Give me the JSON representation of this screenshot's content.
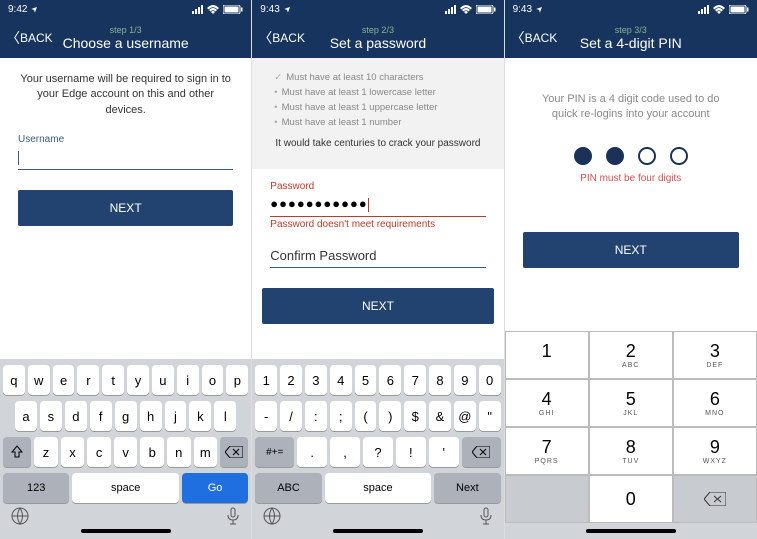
{
  "status": {
    "time": [
      "9:42",
      "9:43",
      "9:43"
    ],
    "location_arrow": "➤"
  },
  "screens": [
    {
      "back": "BACK",
      "step": "step 1/3",
      "title": "Choose a username",
      "helper": "Your username will be required to sign in to your Edge account on this and other devices.",
      "field_label": "Username",
      "next": "NEXT"
    },
    {
      "back": "BACK",
      "step": "step 2/3",
      "title": "Set a password",
      "rules": [
        "Must have at least 10 characters",
        "Must have at least 1 lowercase letter",
        "Must have at least 1 uppercase letter",
        "Must have at least 1 number"
      ],
      "crack": "It would take centuries to crack your password",
      "pw_label": "Password",
      "pw_value": "●●●●●●●●●●●",
      "pw_error": "Password doesn't meet requirements",
      "confirm_label": "Confirm Password",
      "next": "NEXT"
    },
    {
      "back": "BACK",
      "step": "step 3/3",
      "title": "Set a 4-digit PIN",
      "helper": "Your PIN is a 4 digit code used to do quick re-logins into your account",
      "error": "PIN must be four digits",
      "next": "NEXT"
    }
  ],
  "kbd1": {
    "r1": [
      "q",
      "w",
      "e",
      "r",
      "t",
      "y",
      "u",
      "i",
      "o",
      "p"
    ],
    "r2": [
      "a",
      "s",
      "d",
      "f",
      "g",
      "h",
      "j",
      "k",
      "l"
    ],
    "r3": [
      "z",
      "x",
      "c",
      "v",
      "b",
      "n",
      "m"
    ],
    "num": "123",
    "space": "space",
    "go": "Go"
  },
  "kbd2": {
    "r1": [
      "1",
      "2",
      "3",
      "4",
      "5",
      "6",
      "7",
      "8",
      "9",
      "0"
    ],
    "r2": [
      "-",
      "/",
      ":",
      ";",
      "(",
      ")",
      "$",
      "&",
      "@",
      "\""
    ],
    "sym": "#+=",
    "r3": [
      ".",
      ",",
      "?",
      "!",
      "'"
    ],
    "abc": "ABC",
    "space": "space",
    "next": "Next"
  },
  "numpad": {
    "keys": [
      {
        "n": "1",
        "l": ""
      },
      {
        "n": "2",
        "l": "ABC"
      },
      {
        "n": "3",
        "l": "DEF"
      },
      {
        "n": "4",
        "l": "GHI"
      },
      {
        "n": "5",
        "l": "JKL"
      },
      {
        "n": "6",
        "l": "MNO"
      },
      {
        "n": "7",
        "l": "PQRS"
      },
      {
        "n": "8",
        "l": "TUV"
      },
      {
        "n": "9",
        "l": "WXYZ"
      },
      {
        "n": "0",
        "l": ""
      }
    ]
  }
}
